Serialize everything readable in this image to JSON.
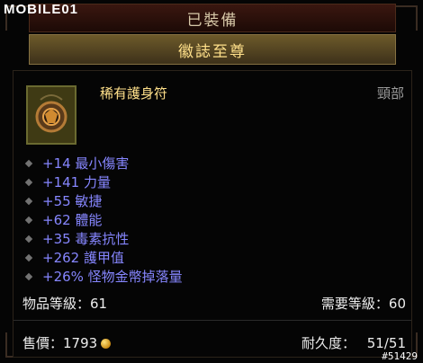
{
  "watermark": {
    "logo": "MOBILE01",
    "image_id": "#51429"
  },
  "tooltip": {
    "header": "已裝備",
    "title": "徽誌至尊",
    "item_name": "稀有護身符",
    "slot": "頸部",
    "stats": [
      {
        "text": "+14 最小傷害"
      },
      {
        "text": "+141 力量"
      },
      {
        "text": "+55 敏捷"
      },
      {
        "text": "+62 體能"
      },
      {
        "text": "+35 毒素抗性"
      },
      {
        "text": "+262 護甲值"
      },
      {
        "text": "+26% 怪物金幣掉落量"
      }
    ],
    "item_level": "物品等級：61",
    "required_level": "需要等級：60",
    "price": "售價：1793",
    "durability_label": "耐久度：",
    "durability_value": "51/51"
  },
  "colors": {
    "stat_blue": "#8686ff",
    "title_gold": "#ffe08a",
    "icon": "amulet-icon"
  }
}
